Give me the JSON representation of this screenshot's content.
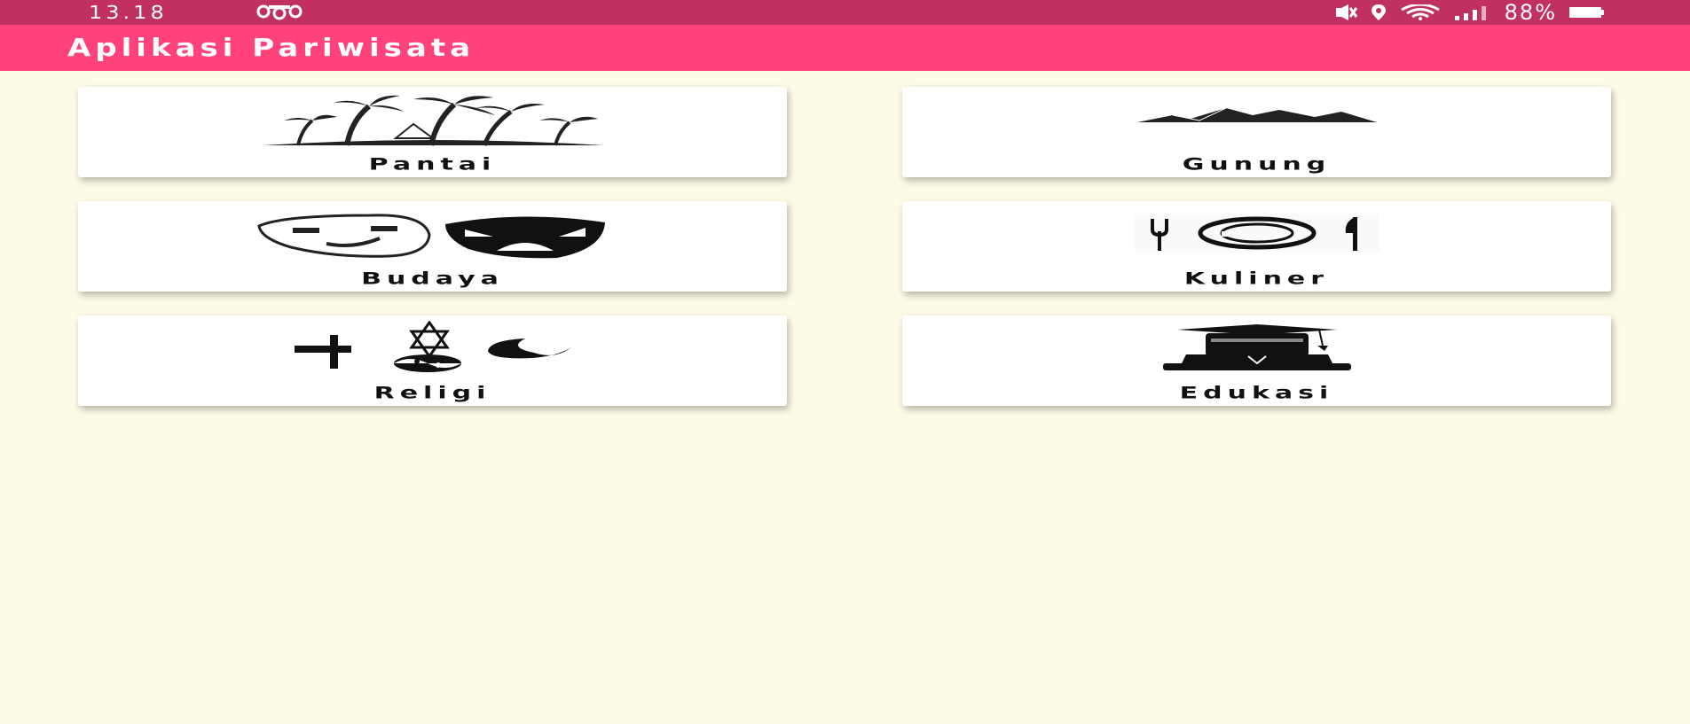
{
  "status_bar": {
    "time": "13.18",
    "battery": "88%",
    "icons": [
      "app-notification-icon",
      "mute-icon",
      "location-icon",
      "wifi-icon",
      "signal-icon",
      "battery-icon"
    ]
  },
  "app_bar": {
    "title": "Aplikasi Pariwisata"
  },
  "categories": [
    {
      "label": "Pantai",
      "icon": "palm-tree-beach-icon"
    },
    {
      "label": "Gunung",
      "icon": "mountain-icon"
    },
    {
      "label": "Budaya",
      "icon": "theater-masks-icon"
    },
    {
      "label": "Kuliner",
      "icon": "plate-cutlery-icon"
    },
    {
      "label": "Religi",
      "icon": "religious-symbols-icon"
    },
    {
      "label": "Edukasi",
      "icon": "graduation-books-icon"
    }
  ],
  "colors": {
    "status_bar": "#c03063",
    "app_bar": "#ff427a",
    "background": "#fdfbe6",
    "card": "#ffffff"
  }
}
